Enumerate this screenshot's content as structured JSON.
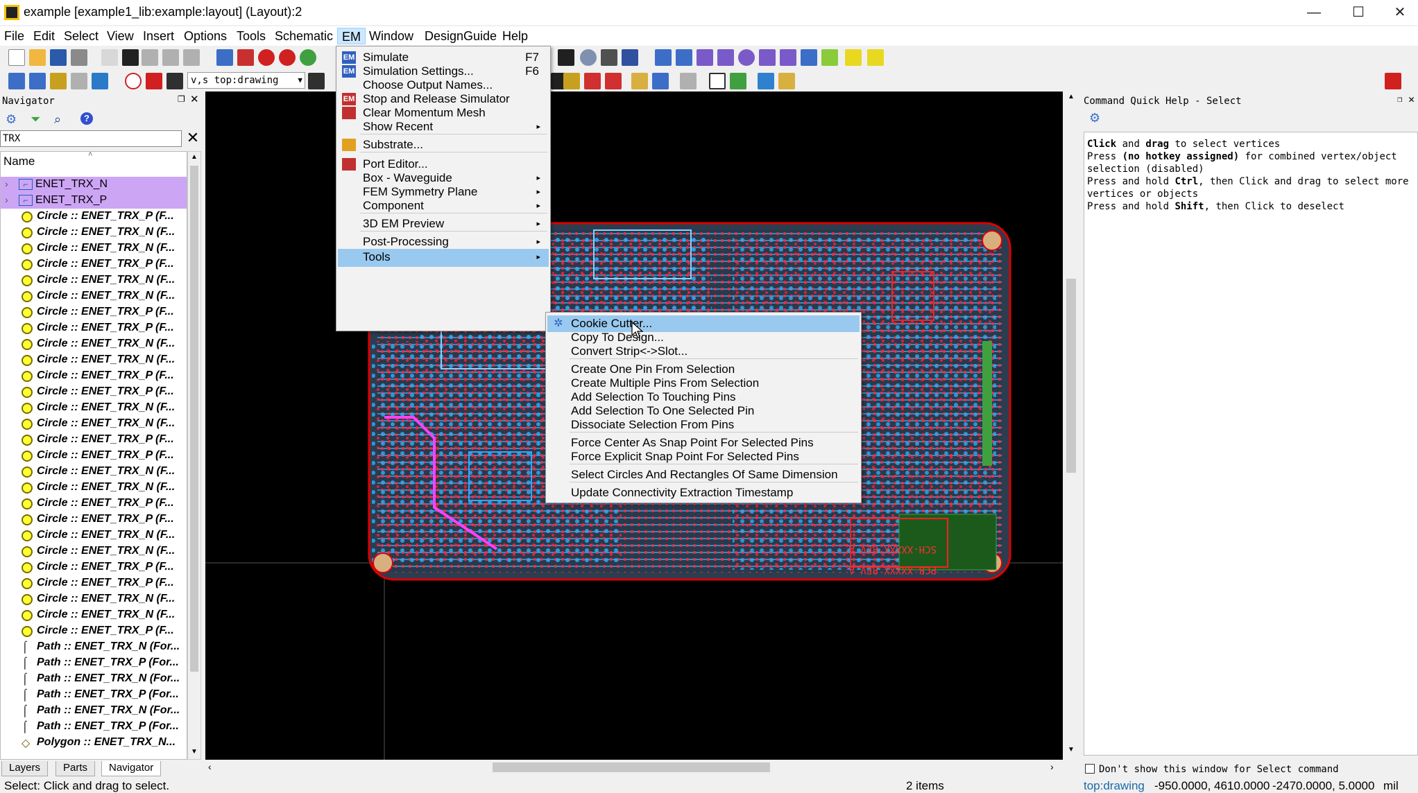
{
  "window": {
    "title": "example [example1_lib:example:layout] (Layout):2",
    "minimize": "—",
    "maximize": "☐",
    "close": "✕"
  },
  "menubar": [
    "File",
    "Edit",
    "Select",
    "View",
    "Insert",
    "Options",
    "Tools",
    "Schematic",
    "EM",
    "Window",
    "DesignGuide",
    "Help"
  ],
  "toolbar": {
    "layer_select": "v,s top:drawing"
  },
  "navigator": {
    "title": "Navigator",
    "search_value": "TRX",
    "column_header": "Name",
    "items": [
      {
        "type": "net",
        "label": "ENET_TRX_N"
      },
      {
        "type": "net",
        "label": "ENET_TRX_P"
      },
      {
        "type": "circle",
        "label": "Circle :: ENET_TRX_P (F..."
      },
      {
        "type": "circle",
        "label": "Circle :: ENET_TRX_N (F..."
      },
      {
        "type": "circle",
        "label": "Circle :: ENET_TRX_N (F..."
      },
      {
        "type": "circle",
        "label": "Circle :: ENET_TRX_P (F..."
      },
      {
        "type": "circle",
        "label": "Circle :: ENET_TRX_N (F..."
      },
      {
        "type": "circle",
        "label": "Circle :: ENET_TRX_N (F..."
      },
      {
        "type": "circle",
        "label": "Circle :: ENET_TRX_P (F..."
      },
      {
        "type": "circle",
        "label": "Circle :: ENET_TRX_P (F..."
      },
      {
        "type": "circle",
        "label": "Circle :: ENET_TRX_N (F..."
      },
      {
        "type": "circle",
        "label": "Circle :: ENET_TRX_N (F..."
      },
      {
        "type": "circle",
        "label": "Circle :: ENET_TRX_P (F..."
      },
      {
        "type": "circle",
        "label": "Circle :: ENET_TRX_P (F..."
      },
      {
        "type": "circle",
        "label": "Circle :: ENET_TRX_N (F..."
      },
      {
        "type": "circle",
        "label": "Circle :: ENET_TRX_N (F..."
      },
      {
        "type": "circle",
        "label": "Circle :: ENET_TRX_P (F..."
      },
      {
        "type": "circle",
        "label": "Circle :: ENET_TRX_P (F..."
      },
      {
        "type": "circle",
        "label": "Circle :: ENET_TRX_N (F..."
      },
      {
        "type": "circle",
        "label": "Circle :: ENET_TRX_N (F..."
      },
      {
        "type": "circle",
        "label": "Circle :: ENET_TRX_P (F..."
      },
      {
        "type": "circle",
        "label": "Circle :: ENET_TRX_P (F..."
      },
      {
        "type": "circle",
        "label": "Circle :: ENET_TRX_N (F..."
      },
      {
        "type": "circle",
        "label": "Circle :: ENET_TRX_N (F..."
      },
      {
        "type": "circle",
        "label": "Circle :: ENET_TRX_P (F..."
      },
      {
        "type": "circle",
        "label": "Circle :: ENET_TRX_P (F..."
      },
      {
        "type": "circle",
        "label": "Circle :: ENET_TRX_N (F..."
      },
      {
        "type": "circle",
        "label": "Circle :: ENET_TRX_N (F..."
      },
      {
        "type": "circle",
        "label": "Circle :: ENET_TRX_P (F..."
      },
      {
        "type": "path",
        "label": "Path :: ENET_TRX_N (For..."
      },
      {
        "type": "path",
        "label": "Path :: ENET_TRX_P (For..."
      },
      {
        "type": "path",
        "label": "Path :: ENET_TRX_N (For..."
      },
      {
        "type": "path",
        "label": "Path :: ENET_TRX_P (For..."
      },
      {
        "type": "path",
        "label": "Path :: ENET_TRX_N (For..."
      },
      {
        "type": "path",
        "label": "Path :: ENET_TRX_P (For..."
      },
      {
        "type": "polygon",
        "label": "Polygon :: ENET_TRX_N..."
      }
    ]
  },
  "em_menu": {
    "items": [
      {
        "label": "Simulate",
        "accel": "F7",
        "icon": "em-icon",
        "submenu": false
      },
      {
        "label": "Simulation Settings...",
        "accel": "F6",
        "icon": "em-icon",
        "submenu": false
      },
      {
        "label": "Choose Output Names...",
        "accel": "",
        "icon": "",
        "submenu": false
      },
      {
        "label": "Stop and Release Simulator",
        "accel": "",
        "icon": "em-stop-icon",
        "submenu": false
      },
      {
        "label": "Clear Momentum Mesh",
        "accel": "",
        "icon": "mesh-icon",
        "submenu": false
      },
      {
        "label": "Show Recent",
        "accel": "",
        "icon": "",
        "submenu": true
      },
      {
        "label": "Substrate...",
        "accel": "",
        "icon": "substrate-icon",
        "submenu": false
      },
      {
        "label": "Port Editor...",
        "accel": "",
        "icon": "port-icon",
        "submenu": false
      },
      {
        "label": "Box - Waveguide",
        "accel": "",
        "icon": "",
        "submenu": true
      },
      {
        "label": "FEM Symmetry Plane",
        "accel": "",
        "icon": "",
        "submenu": true
      },
      {
        "label": "Component",
        "accel": "",
        "icon": "",
        "submenu": true
      },
      {
        "label": "3D EM Preview",
        "accel": "",
        "icon": "",
        "submenu": true
      },
      {
        "label": "Post-Processing",
        "accel": "",
        "icon": "",
        "submenu": true
      },
      {
        "label": "Tools",
        "accel": "",
        "icon": "",
        "submenu": true
      }
    ]
  },
  "tools_menu": {
    "items": [
      "Cookie Cutter...",
      "Copy To Design...",
      "Convert Strip<->Slot...",
      "Create One Pin From Selection",
      "Create Multiple Pins From Selection",
      "Add Selection To Touching Pins",
      "Add Selection To One Selected Pin",
      "Dissociate Selection From Pins",
      "Force Center As Snap Point For Selected Pins",
      "Force Explicit Snap Point For Selected Pins",
      "Select Circles And Rectangles Of Same Dimension",
      "Update Connectivity Extraction Timestamp"
    ]
  },
  "pcb_silkscreen": [
    "SCH-XXXXX REV A",
    "PCB-XXXXX REV A"
  ],
  "help_panel": {
    "title": "Command Quick Help - Select",
    "lines": [
      [
        "Click",
        " and ",
        "drag",
        " to select vertices"
      ],
      [
        "Press ",
        "(no hotkey assigned)",
        " for combined vertex/object"
      ],
      [
        "selection (disabled)"
      ],
      [
        "Press and hold ",
        "Ctrl",
        ", then Click and drag to select more"
      ],
      [
        "vertices or objects"
      ],
      [
        "Press and hold ",
        "Shift",
        ", then Click to deselect"
      ]
    ],
    "checkbox_label": "Don't show this window for Select command"
  },
  "bottom_tabs": [
    "Layers",
    "Parts",
    "Navigator"
  ],
  "status": {
    "message": "Select: Click and drag to select.",
    "items": "2 items",
    "layer": "top:drawing",
    "coords1": "-950.0000, 4610.0000",
    "coords2": "-2470.0000, 5.0000",
    "units": "mil"
  },
  "colors": {
    "selection": "#cda5f5",
    "menu_highlight": "#99c9ef",
    "pcb_edge": "#e00000",
    "trace_blue": "#33a6ff"
  }
}
